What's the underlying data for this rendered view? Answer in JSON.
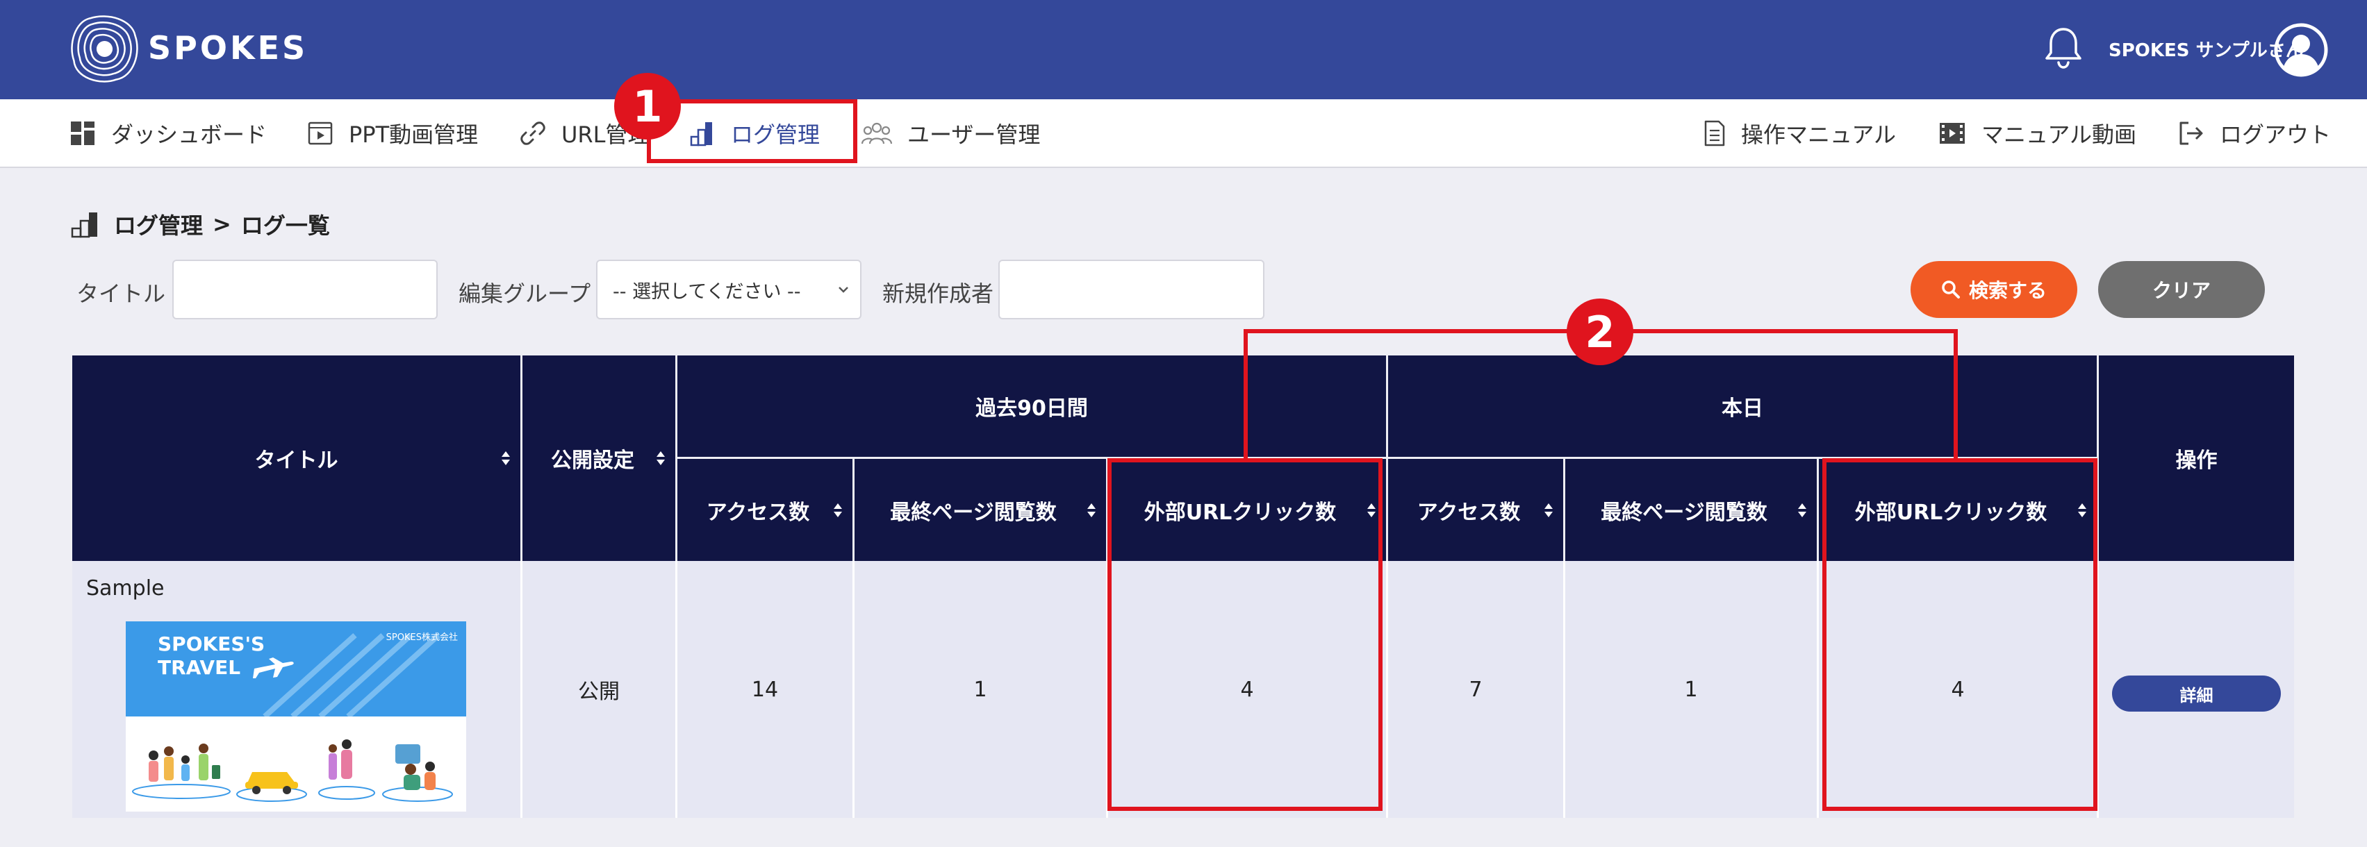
{
  "header": {
    "brand": "SPOKES",
    "username": "SPOKES サンプルさん"
  },
  "nav": {
    "left": [
      {
        "label": "ダッシュボード",
        "icon": "dashboard-icon"
      },
      {
        "label": "PPT動画管理",
        "icon": "video-file-icon"
      },
      {
        "label": "URL管理",
        "icon": "link-icon"
      },
      {
        "label": "ログ管理",
        "icon": "log-chart-icon",
        "active": true
      },
      {
        "label": "ユーザー管理",
        "icon": "users-icon"
      }
    ],
    "right": [
      {
        "label": "操作マニュアル",
        "icon": "manual-icon"
      },
      {
        "label": "マニュアル動画",
        "icon": "film-icon"
      },
      {
        "label": "ログアウト",
        "icon": "logout-icon"
      }
    ]
  },
  "breadcrumb": {
    "section": "ログ管理",
    "separator": ">",
    "page": "ログ一覧"
  },
  "filters": {
    "title_label": "タイトル",
    "title_value": "",
    "group_label": "編集グループ",
    "group_selected": "-- 選択してください --",
    "creator_label": "新規作成者",
    "creator_value": "",
    "search_button": "検索する",
    "clear_button": "クリア"
  },
  "table": {
    "headers": {
      "title": "タイトル",
      "publish": "公開設定",
      "past90": "過去90日間",
      "today": "本日",
      "access": "アクセス数",
      "last_page": "最終ページ閲覧数",
      "ext_click": "外部URLクリック数",
      "action": "操作"
    },
    "rows": [
      {
        "title": "Sample",
        "thumbnail_title": "SPOKES'S\nTRAVEL",
        "thumbnail_company": "SPOKES株式会社",
        "publish": "公開",
        "past90_access": "14",
        "past90_last_page": "1",
        "past90_ext_click": "4",
        "today_access": "7",
        "today_last_page": "1",
        "today_ext_click": "4",
        "action": "詳細"
      }
    ]
  },
  "annotations": {
    "badge1": "1",
    "badge2": "2"
  },
  "colors": {
    "header_bg": "#34489a",
    "table_header_bg": "#111544",
    "row_bg": "#e6e7f3",
    "search_button": "#f15a24",
    "clear_button": "#6f6f6f",
    "annotation_red": "#e0141e"
  }
}
